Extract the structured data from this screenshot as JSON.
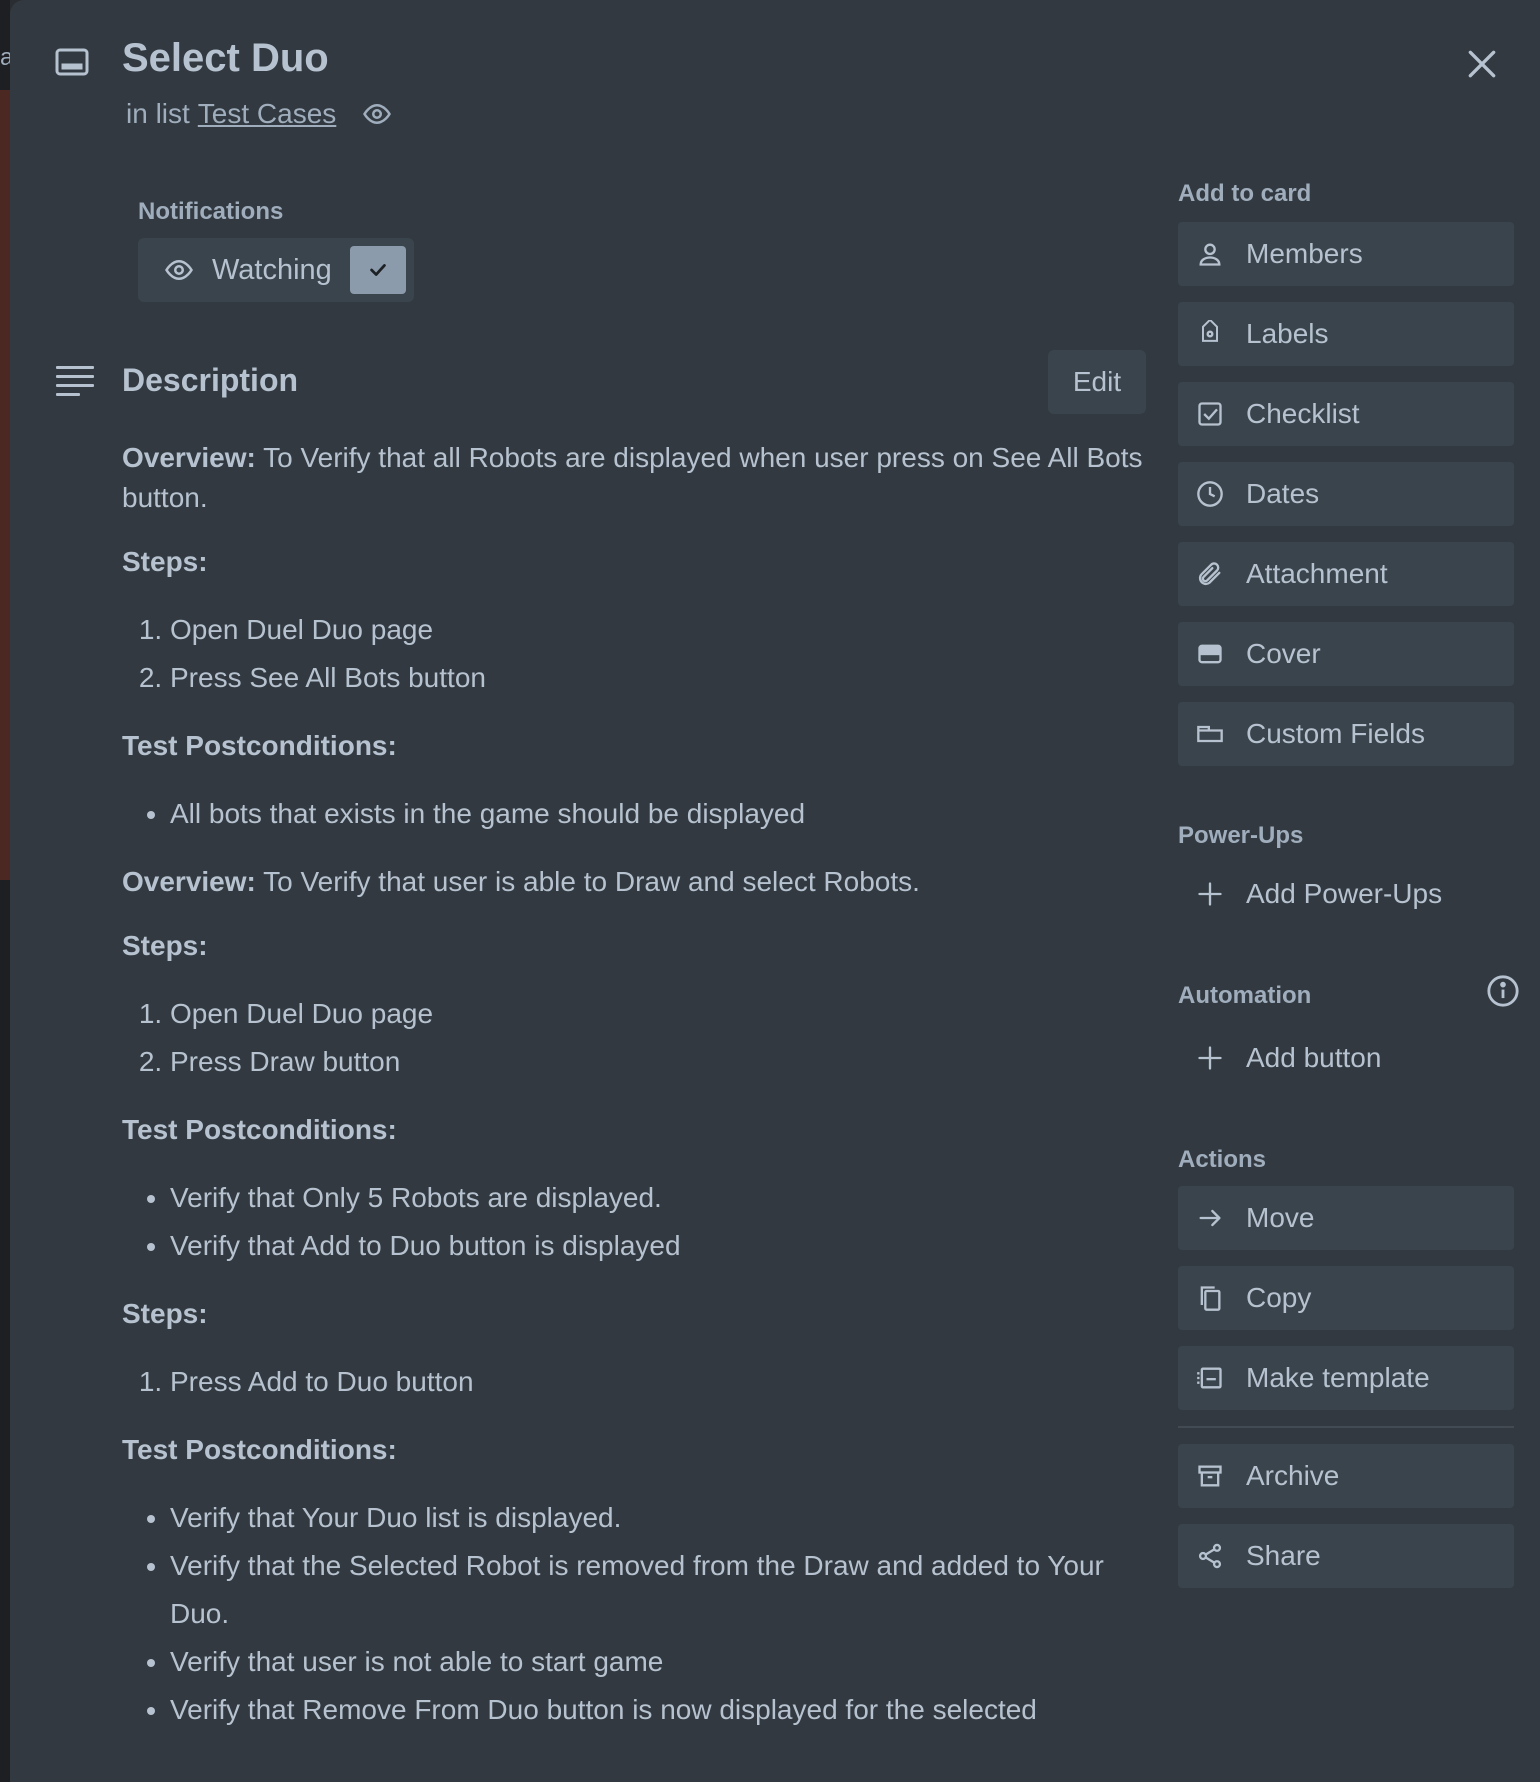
{
  "backdrop": {
    "letter": "a"
  },
  "card": {
    "title": "Select Duo",
    "in_list_prefix": "in list",
    "list_name": "Test Cases"
  },
  "notifications": {
    "label": "Notifications",
    "watch_label": "Watching"
  },
  "description": {
    "heading": "Description",
    "edit_label": "Edit",
    "overview1_label": "Overview:",
    "overview1_text": " To Verify that all Robots are displayed when user press on See All Bots button.",
    "steps_label": "Steps:",
    "steps1": [
      "Open Duel Duo page",
      "Press See All Bots button"
    ],
    "post_label": "Test Postconditions:",
    "post1": [
      "All bots that exists in the game should be displayed"
    ],
    "overview2_label": "Overview:",
    "overview2_text": " To Verify that user is able to Draw and select Robots.",
    "steps2": [
      "Open Duel Duo page",
      "Press Draw button"
    ],
    "post2": [
      "Verify that Only 5 Robots are displayed.",
      "Verify that Add to Duo button is displayed"
    ],
    "steps3": [
      "Press Add to Duo button"
    ],
    "post3": [
      "Verify that Your Duo list is displayed.",
      "Verify that the Selected Robot is removed from the Draw and added to Your Duo.",
      "Verify that user is not able to start game",
      "Verify that Remove From Duo button is now displayed for the selected"
    ]
  },
  "sidebar": {
    "add_to_card_label": "Add to card",
    "add_to_card": [
      "Members",
      "Labels",
      "Checklist",
      "Dates",
      "Attachment",
      "Cover",
      "Custom Fields"
    ],
    "powerups_label": "Power-Ups",
    "add_powerups": "Add Power-Ups",
    "automation_label": "Automation",
    "add_button": "Add button",
    "actions_label": "Actions",
    "actions": [
      "Move",
      "Copy",
      "Make template"
    ],
    "actions2": [
      "Archive",
      "Share"
    ]
  },
  "icons": {
    "card": "card-icon",
    "close": "close-icon",
    "eye": "eye-icon",
    "check": "check-icon",
    "description": "description-icon",
    "person": "person-icon",
    "tag": "tag-icon",
    "checklist": "checklist-icon",
    "clock": "clock-icon",
    "paperclip": "paperclip-icon",
    "cover": "cover-icon",
    "custom-fields": "custom-fields-icon",
    "plus": "plus-icon",
    "info": "info-icon",
    "arrow": "arrow-right-icon",
    "copy": "copy-icon",
    "template": "template-icon",
    "archive": "archive-icon",
    "share": "share-icon"
  }
}
